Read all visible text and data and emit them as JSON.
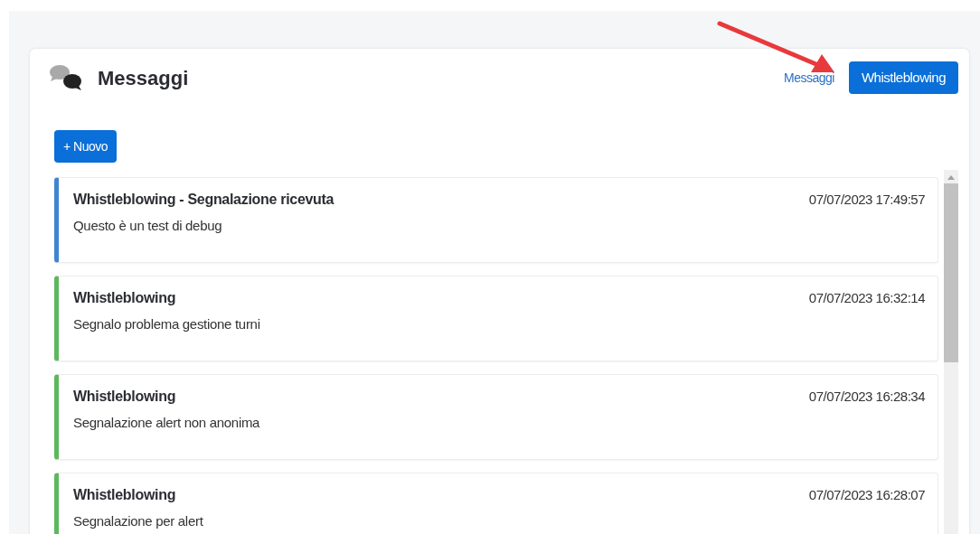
{
  "header": {
    "title": "Messaggi"
  },
  "tabs": [
    {
      "label": "Messaggi",
      "selected": false
    },
    {
      "label": "Whistleblowing",
      "selected": true
    }
  ],
  "new_button": {
    "label": "+ Nuovo"
  },
  "messages": [
    {
      "title": "Whistleblowing - Segnalazione ricevuta",
      "text": "Questo è un test di debug",
      "time": "07/07/2023 17:49:57",
      "color": "#3d85d1"
    },
    {
      "title": "Whistleblowing",
      "text": "Segnalo problema gestione turni",
      "time": "07/07/2023 16:32:14",
      "color": "#5cb85c"
    },
    {
      "title": "Whistleblowing",
      "text": "Segnalazione alert non anonima",
      "time": "07/07/2023 16:28:34",
      "color": "#5cb85c"
    },
    {
      "title": "Whistleblowing",
      "text": "Segnalazione per alert",
      "time": "07/07/2023 16:28:07",
      "color": "#5cb85c"
    }
  ]
}
